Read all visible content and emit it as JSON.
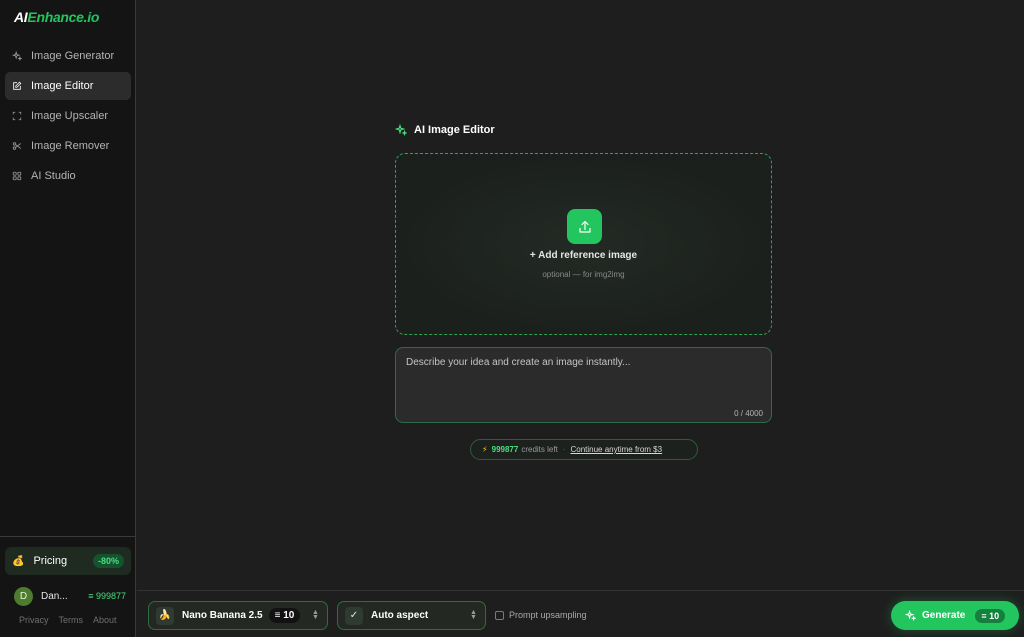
{
  "brand": {
    "logo_prefix": "AI",
    "logo_suffix": "Enhance.io",
    "accent": "#22c55e"
  },
  "sidebar": {
    "items": [
      {
        "label": "Image Generator",
        "icon": "sparkles-icon",
        "active": false
      },
      {
        "label": "Image Editor",
        "icon": "edit-icon",
        "active": true
      },
      {
        "label": "Image Upscaler",
        "icon": "expand-icon",
        "active": false
      },
      {
        "label": "Image Remover",
        "icon": "scissors-icon",
        "active": false
      },
      {
        "label": "AI Studio",
        "icon": "grid-icon",
        "active": false
      }
    ],
    "pricing": {
      "label": "Pricing",
      "badge": "-80%",
      "icon": "money-bag-icon"
    },
    "user": {
      "initial": "D",
      "name": "Dan...",
      "credits": "≡ 999877"
    },
    "footer": {
      "privacy": "Privacy",
      "terms": "Terms",
      "about": "About"
    }
  },
  "editor": {
    "title": "AI Image Editor",
    "dropzone": {
      "title": "+ Add reference image",
      "subtitle": "optional — for img2img"
    },
    "prompt": {
      "placeholder": "Describe your idea and create an image instantly...",
      "value": "",
      "char_count": "0 / 4000"
    },
    "credits": {
      "amount": "999877",
      "suffix": "credits left",
      "separator": "·",
      "link": "Continue anytime from $3"
    }
  },
  "toolbar": {
    "model": {
      "icon": "🍌",
      "label": "Nano Banana 2.5",
      "cost": "≡ 10"
    },
    "aspect": {
      "icon": "✓",
      "label": "Auto aspect"
    },
    "upsampling": {
      "label": "Prompt upsampling",
      "checked": false
    },
    "generate": {
      "label": "Generate",
      "cost": "≡ 10"
    }
  }
}
